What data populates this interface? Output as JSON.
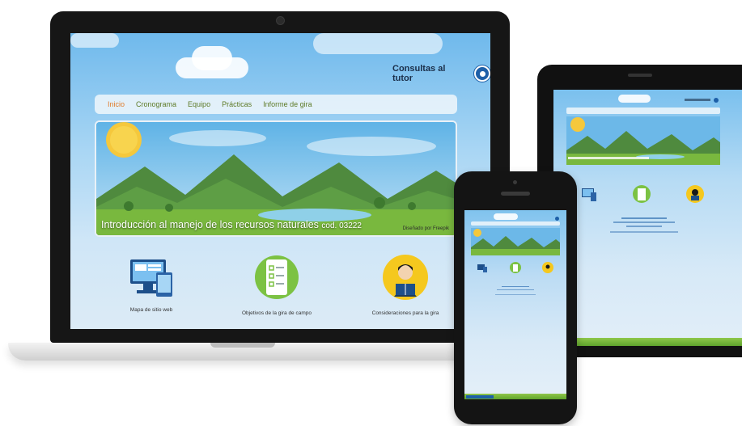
{
  "laptop": {
    "tutor_label": "Consultas al tutor",
    "nav": [
      "Inicio",
      "Cronograma",
      "Equipo",
      "Prácticas",
      "Informe de gira"
    ],
    "banner": {
      "title": "Introducción al manejo de los recursos naturales",
      "code": "cod. 03222",
      "credit": "Diseñado por Freepik"
    },
    "features": [
      {
        "label": "Mapa de sitio web",
        "icon": "website-devices-icon"
      },
      {
        "label": "Objetivos de la gira de campo",
        "icon": "checklist-icon"
      },
      {
        "label": "Consideraciones para la gira",
        "icon": "reader-person-icon"
      }
    ]
  },
  "colors": {
    "nav_active": "#e07b2a",
    "nav_link": "#5d7a26",
    "tutor_icon": "#1d5fa8",
    "grass": "#6cb033"
  }
}
